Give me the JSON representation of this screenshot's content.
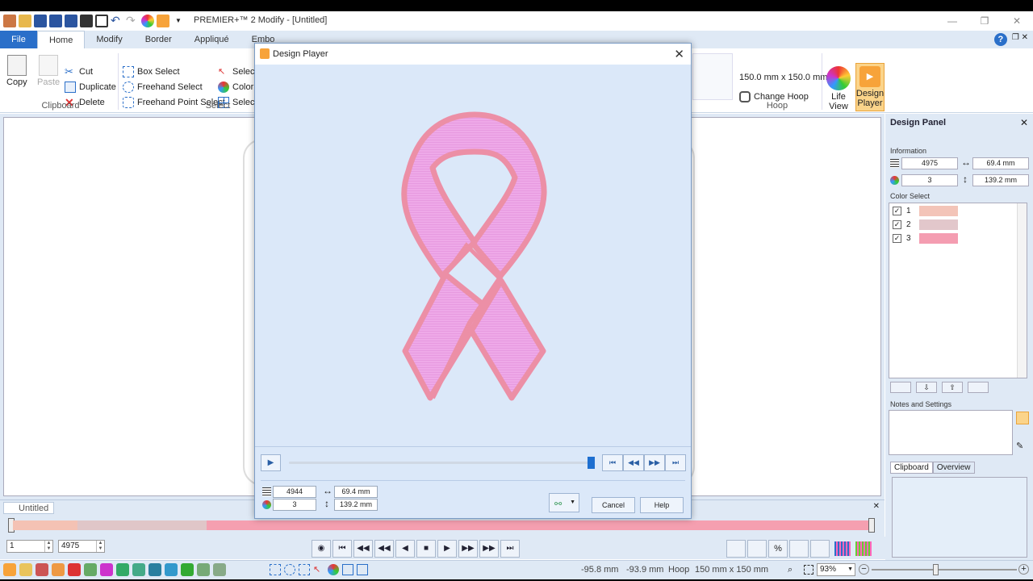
{
  "app": {
    "title": "PREMIER+™ 2 Modify - [Untitled]",
    "tabs": [
      "File",
      "Home",
      "Modify",
      "Border",
      "Appliqué",
      "Embo"
    ],
    "active_tab": "Home"
  },
  "ribbon": {
    "clipboard": {
      "label": "Clipboard",
      "copy": "Copy",
      "paste": "Paste",
      "cut": "Cut",
      "duplicate": "Duplicate",
      "delete": "Delete"
    },
    "select": {
      "label": "Select",
      "box_select": "Box Select",
      "freehand_select": "Freehand Select",
      "freehand_point_select": "Freehand Point Select",
      "select_1": "Select",
      "color": "Color",
      "select_2": "Select"
    },
    "hoop": {
      "label": "Hoop",
      "size": "150.0 mm x 150.0 mm",
      "change_hoop": "Change Hoop"
    },
    "life_view": "Life\nView",
    "design_player": "Design\nPlayer"
  },
  "document_tab": "Untitled",
  "colorbar": {
    "segments": [
      "#f4c2b4",
      "#e0c6c8",
      "#f59fb0"
    ]
  },
  "controls": {
    "start_value": "1",
    "end_value": "4975"
  },
  "status": {
    "x": "-95.8 mm",
    "y": "-93.9 mm",
    "hoop_label": "Hoop",
    "hoop_size": "150 mm x 150 mm",
    "zoom": "93%"
  },
  "design_panel": {
    "title": "Design Panel",
    "information_label": "Information",
    "stitches": "4975",
    "width": "69.4 mm",
    "colors": "3",
    "height": "139.2 mm",
    "color_select_label": "Color Select",
    "color_rows": [
      {
        "num": "1",
        "check": "✓",
        "color": "#f3c4b8"
      },
      {
        "num": "2",
        "check": "✓",
        "color": "#e2c7cb"
      },
      {
        "num": "3",
        "check": "✓",
        "color": "#f49db1"
      }
    ],
    "notes_label": "Notes and Settings",
    "tab_clipboard": "Clipboard",
    "tab_overview": "Overview"
  },
  "dialog": {
    "title": "Design Player",
    "stitches": "4944",
    "colors": "3",
    "width": "69.4 mm",
    "height": "139.2 mm",
    "cancel": "Cancel",
    "help": "Help",
    "progress": 0.99
  }
}
